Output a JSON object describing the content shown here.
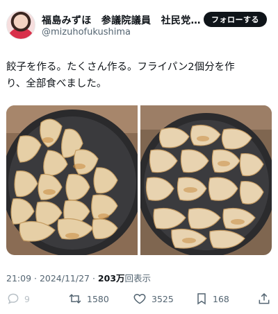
{
  "author": {
    "display_name": "福島みずほ　参議院議員　社民党…",
    "handle": "@mizuhofukushima"
  },
  "follow_button": {
    "label": "フォローする"
  },
  "tweet": {
    "text_line1": "餃子を作る。たくさん作る。フライパン2個分を作",
    "text_line2": "り、全部食べました。"
  },
  "media": {
    "photos": [
      {
        "alt": "gyoza-in-frying-pan-1"
      },
      {
        "alt": "gyoza-in-frying-pan-2"
      }
    ]
  },
  "meta": {
    "time": "21:09",
    "separator": " · ",
    "date": "2024/11/27",
    "views_count": "203万",
    "views_label": "回表示"
  },
  "actions": {
    "reply_count": "9",
    "repost_count": "1580",
    "like_count": "3525",
    "bookmark_count": "168"
  },
  "colors": {
    "text_primary": "#0f1419",
    "text_secondary": "#536471",
    "follow_bg": "#0f1419"
  },
  "icons": [
    "reply-icon",
    "repost-icon",
    "like-icon",
    "bookmark-icon",
    "share-icon"
  ]
}
